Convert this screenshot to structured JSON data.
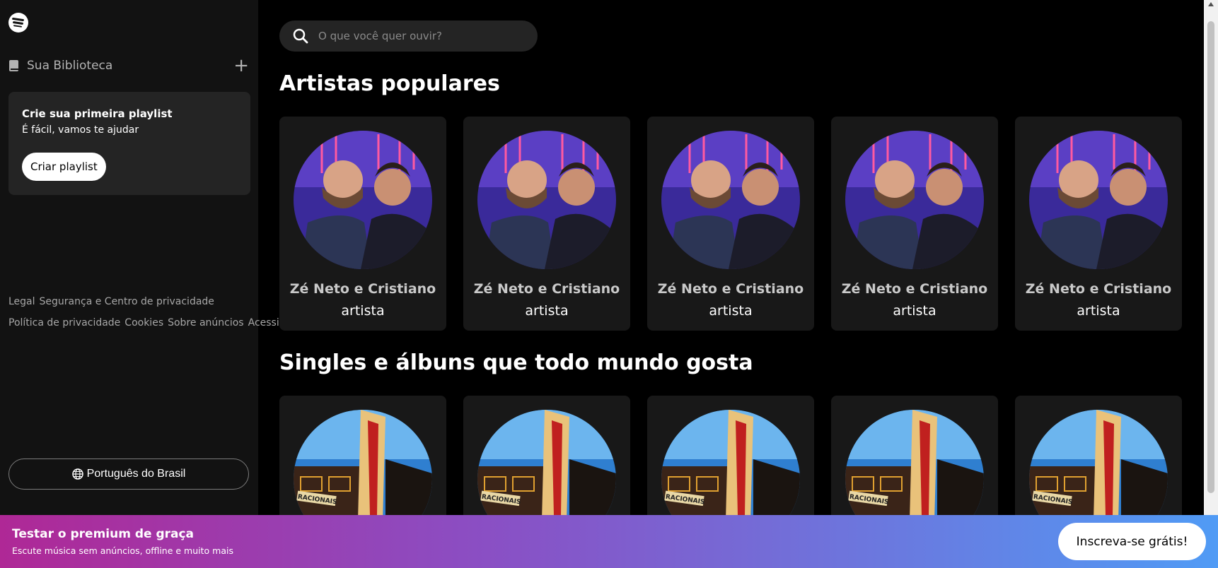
{
  "sidebar": {
    "library_label": "Sua Biblioteca",
    "add_icon": "plus-icon",
    "create_card": {
      "title": "Crie sua primeira playlist",
      "subtitle": "É fácil, vamos te ajudar",
      "button_label": "Criar playlist"
    },
    "legal_links": [
      "Legal",
      "Segurança e Centro de privacidade",
      "Política de privacidade",
      "Cookies",
      "Sobre anúncios",
      "Acessibilidade"
    ],
    "language_button": "Português do Brasil"
  },
  "search": {
    "placeholder": "O que você quer ouvir?"
  },
  "sections": [
    {
      "title": "Artistas populares",
      "cards": [
        {
          "title": "Zé Neto e Cristiano",
          "subtitle": "artista"
        },
        {
          "title": "Zé Neto e Cristiano",
          "subtitle": "artista"
        },
        {
          "title": "Zé Neto e Cristiano",
          "subtitle": "artista"
        },
        {
          "title": "Zé Neto e Cristiano",
          "subtitle": "artista"
        },
        {
          "title": "Zé Neto e Cristiano",
          "subtitle": "artista"
        }
      ]
    },
    {
      "title": "Singles e álbuns que todo mundo gosta",
      "cards": [
        {},
        {},
        {},
        {},
        {}
      ]
    }
  ],
  "album_art_text": "RACIONAIS",
  "promo": {
    "title": "Testar o premium de graça",
    "subtitle": "Escute música sem anúncios, offline e muito mais",
    "button_label": "Inscreva-se grátis!"
  },
  "colors": {
    "background": "#000000",
    "sidebar": "#121212",
    "card": "#181818",
    "promo_start": "#af2896",
    "promo_end": "#509bf5"
  }
}
